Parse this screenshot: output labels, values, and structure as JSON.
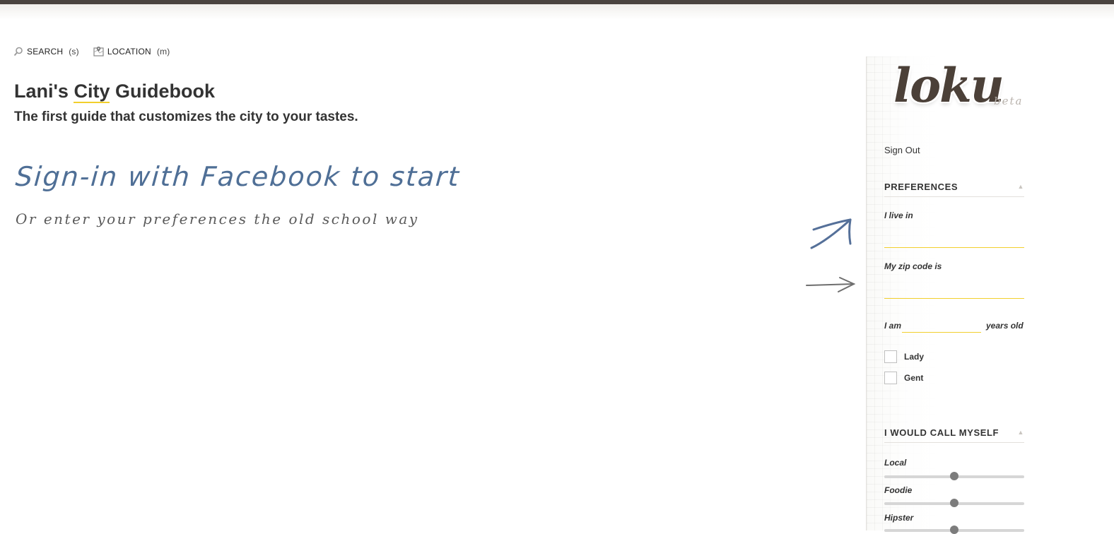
{
  "nav": {
    "search_label": "SEARCH",
    "search_key": "(s)",
    "search_icon": "search-icon",
    "location_label": "LOCATION",
    "location_key": "(m)",
    "location_icon": "map-icon"
  },
  "header": {
    "title_prefix": "Lani's",
    "title_highlight": "City",
    "title_suffix": "Guidebook",
    "tagline": "The first guide that customizes the city to your tastes."
  },
  "cta": {
    "facebook_text": "Sign-in with Facebook to start",
    "oldschool_text": "Or enter your preferences the old school way"
  },
  "sidebar": {
    "logo": "loku",
    "badge": "beta",
    "signout": "Sign Out",
    "preferences": {
      "heading": "PREFERENCES",
      "live_in_label": "I live in",
      "live_in_value": "",
      "zip_label": "My zip code is",
      "zip_value": "",
      "age_prefix": "I am",
      "age_suffix": "years old",
      "age_value": "",
      "gender_options": [
        "Lady",
        "Gent"
      ]
    },
    "call_myself": {
      "heading": "I WOULD CALL MYSELF",
      "sliders": [
        {
          "label": "Local",
          "value": 0.5
        },
        {
          "label": "Foodie",
          "value": 0.5
        },
        {
          "label": "Hipster",
          "value": 0.5
        }
      ]
    }
  },
  "colors": {
    "accent_yellow": "#f2cf2d",
    "logo_brown": "#4b4038",
    "facebook_blue": "#4f6f96",
    "topbar": "#4a4440"
  }
}
